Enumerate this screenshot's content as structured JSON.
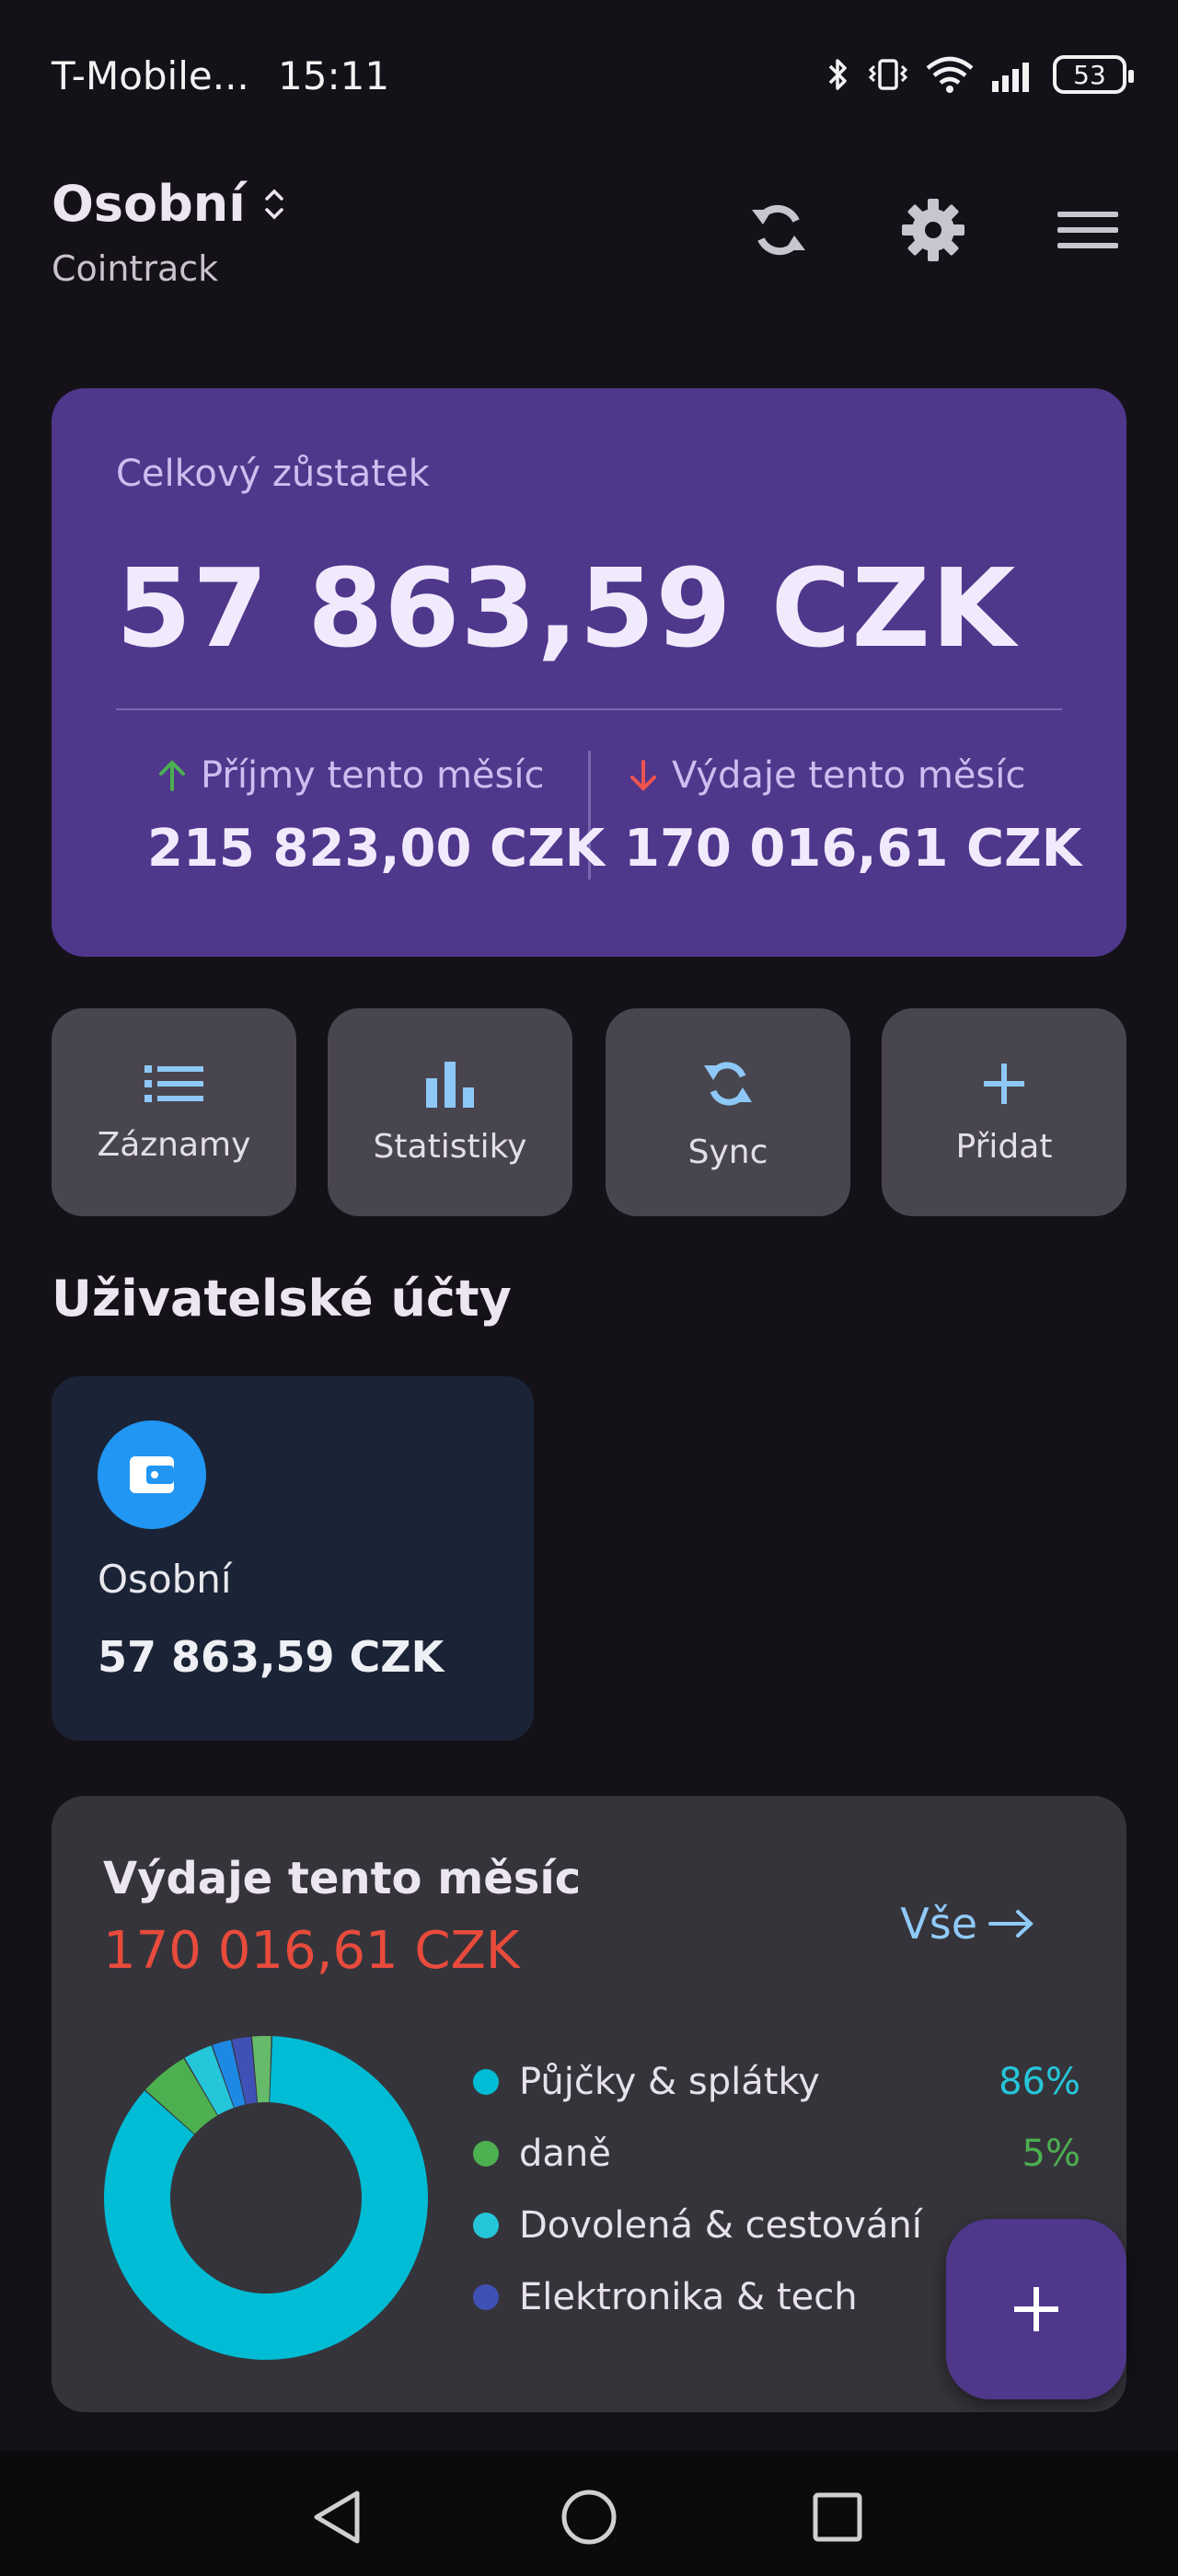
{
  "status_bar": {
    "carrier": "T-Mobile...",
    "time": "15:11",
    "battery": "53"
  },
  "header": {
    "profile_name": "Osobní",
    "app_name": "Cointrack",
    "icons": [
      "sort-toggle-icon",
      "sync-icon",
      "gear-icon",
      "menu-icon"
    ]
  },
  "balance": {
    "label": "Celkový zůstatek",
    "amount": "57 863,59 CZK",
    "income_label": "Příjmy tento měsíc",
    "income_value": "215 823,00 CZK",
    "expense_label": "Výdaje tento měsíc",
    "expense_value": "170 016,61 CZK",
    "income_color": "#4caf50",
    "expense_color": "#ef5350"
  },
  "actions": [
    {
      "label": "Záznamy",
      "icon": "list-icon"
    },
    {
      "label": "Statistiky",
      "icon": "bar-chart-icon"
    },
    {
      "label": "Sync",
      "icon": "sync-icon"
    },
    {
      "label": "Přidat",
      "icon": "plus-icon"
    }
  ],
  "accounts": {
    "title": "Uživatelské účty",
    "items": [
      {
        "name": "Osobní",
        "balance": "57 863,59 CZK",
        "icon": "wallet-icon",
        "color": "#2196f3"
      }
    ]
  },
  "expenses": {
    "title": "Výdaje tento měsíc",
    "amount": "170 016,61 CZK",
    "view_all": "Vše",
    "categories": [
      {
        "name": "Půjčky & splátky",
        "percent": "86%",
        "share": 86,
        "color": "#00bcd4"
      },
      {
        "name": "daně",
        "percent": "5%",
        "share": 5,
        "color": "#4caf50"
      },
      {
        "name": "Dovolená & cestování",
        "percent": "",
        "share": 3,
        "color": "#26c6da"
      },
      {
        "name": "Elektronika & tech",
        "percent": "",
        "share": 2,
        "color": "#3f51b5"
      }
    ],
    "other_share": 4,
    "other_colors": [
      "#1e88e5",
      "#66bb6a"
    ]
  },
  "fab": {
    "icon": "plus-icon"
  },
  "nav": [
    "back-icon",
    "home-icon",
    "recents-icon"
  ]
}
